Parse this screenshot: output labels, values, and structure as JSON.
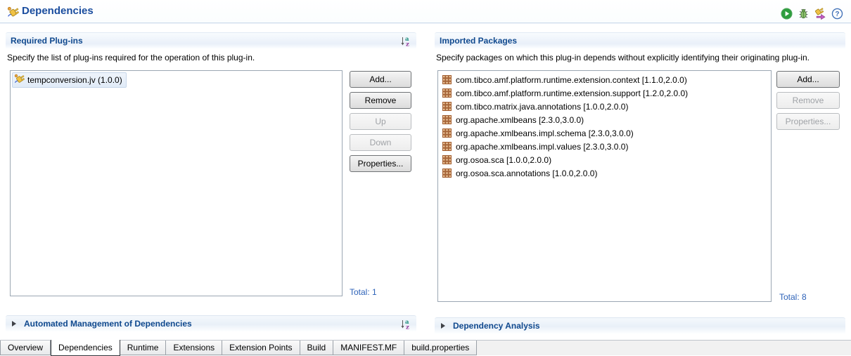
{
  "header": {
    "title": "Dependencies",
    "toolbar_icons": [
      "run-icon",
      "debug-icon",
      "export-plugin-icon",
      "help-icon"
    ]
  },
  "required_plugins": {
    "title": "Required Plug-ins",
    "description": "Specify the list of plug-ins required for the operation of this plug-in.",
    "items": [
      {
        "label": "tempconversion.jv (1.0.0)",
        "icon": "plugin-icon",
        "selected": true
      }
    ],
    "buttons": [
      {
        "label": "Add...",
        "enabled": true
      },
      {
        "label": "Remove",
        "enabled": true
      },
      {
        "label": "Up",
        "enabled": false
      },
      {
        "label": "Down",
        "enabled": false
      },
      {
        "label": "Properties...",
        "enabled": true
      }
    ],
    "total_label": "Total: 1",
    "sort_icon": "sort-az-icon"
  },
  "imported_packages": {
    "title": "Imported Packages",
    "description": "Specify packages on which this plug-in depends without explicitly identifying their originating plug-in.",
    "items": [
      "com.tibco.amf.platform.runtime.extension.context [1.1.0,2.0.0)",
      "com.tibco.amf.platform.runtime.extension.support [1.2.0,2.0.0)",
      "com.tibco.matrix.java.annotations [1.0.0,2.0.0)",
      "org.apache.xmlbeans [2.3.0,3.0.0)",
      "org.apache.xmlbeans.impl.schema [2.3.0,3.0.0)",
      "org.apache.xmlbeans.impl.values [2.3.0,3.0.0)",
      "org.osoa.sca [1.0.0,2.0.0)",
      "org.osoa.sca.annotations [1.0.0,2.0.0)"
    ],
    "item_icon": "package-icon",
    "buttons": [
      {
        "label": "Add...",
        "enabled": true
      },
      {
        "label": "Remove",
        "enabled": false
      },
      {
        "label": "Properties...",
        "enabled": false
      }
    ],
    "total_label": "Total: 8"
  },
  "collapsed_sections": [
    {
      "title": "Automated Management of Dependencies",
      "has_sort_icon": true
    },
    {
      "title": "Dependency Analysis",
      "has_sort_icon": false
    }
  ],
  "tabs": {
    "items": [
      "Overview",
      "Dependencies",
      "Runtime",
      "Extensions",
      "Extension Points",
      "Build",
      "MANIFEST.MF",
      "build.properties"
    ],
    "active": "Dependencies"
  },
  "colors": {
    "title_blue": "#1a4d9e",
    "section_title_blue": "#10498e",
    "total_blue": "#2d62b8",
    "run_green": "#2e9e3e",
    "help_blue": "#4272b8",
    "package_tan": "#ebc79e",
    "package_brown": "#a05a2c",
    "plug_gold": "#f0c245"
  }
}
